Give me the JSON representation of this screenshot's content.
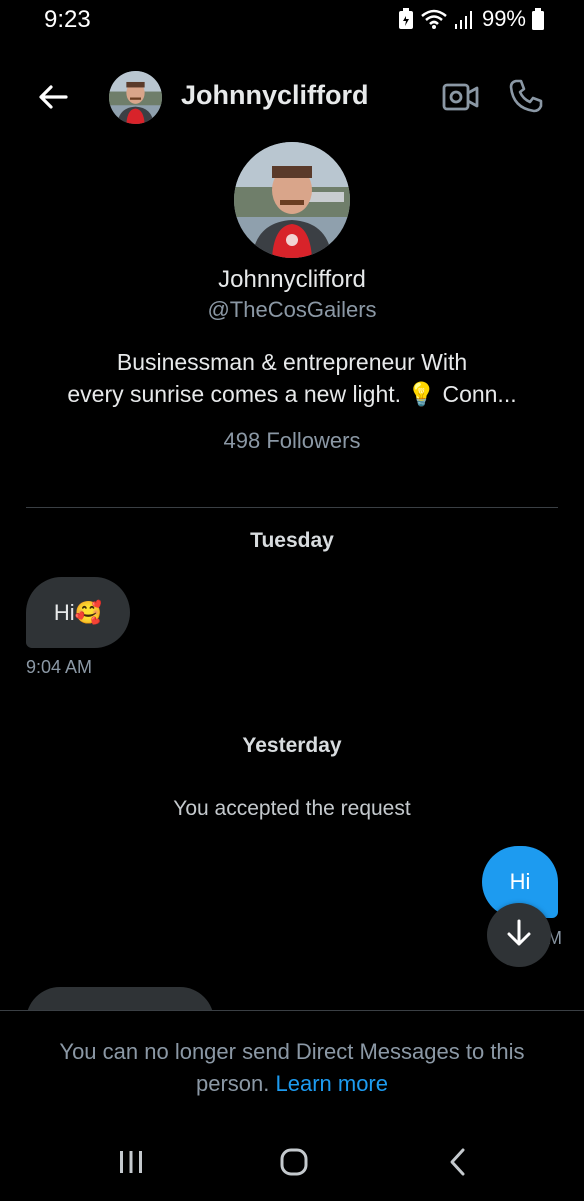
{
  "status_bar": {
    "time": "9:23",
    "battery": "99%",
    "icons": [
      "battery-saver-icon",
      "wifi-icon",
      "signal-icon",
      "battery-icon"
    ]
  },
  "header": {
    "title": "Johnnyclifford",
    "icons": [
      "back-arrow-icon",
      "video-call-icon",
      "phone-call-icon"
    ]
  },
  "profile": {
    "name": "Johnnyclifford",
    "handle": "@TheCosGailers",
    "bio_line1": "Businessman & entrepreneur With",
    "bio_line2_before": "every sunrise comes a new light. ",
    "bio_emoji": "💡",
    "bio_line2_after": " Conn...",
    "followers": "498 Followers"
  },
  "conversation": {
    "day1": "Tuesday",
    "incoming_text": "Hi",
    "incoming_emoji": "🥰",
    "incoming_time": "9:04 AM",
    "day2": "Yesterday",
    "system_message": "You accepted the request",
    "outgoing_text": "Hi",
    "outgoing_time_stub": "M"
  },
  "footer": {
    "notice": "You can no longer send Direct Messages to this person. ",
    "link": "Learn more"
  },
  "colors": {
    "background": "#000000",
    "accent": "#1d9bf0",
    "bubble_in": "#2f3336",
    "secondary_text": "#8b98a5"
  }
}
